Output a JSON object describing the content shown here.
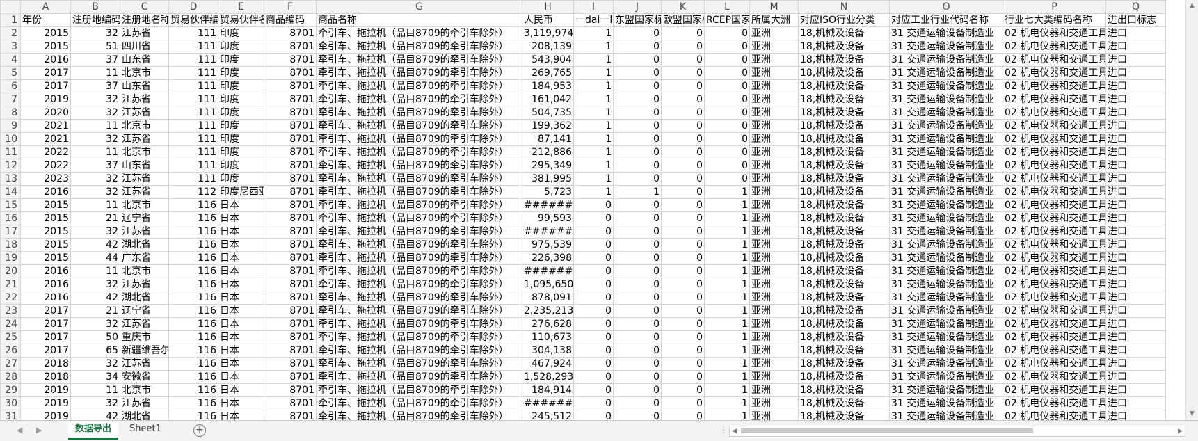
{
  "columns": [
    "A",
    "B",
    "C",
    "D",
    "E",
    "F",
    "G",
    "H",
    "I",
    "J",
    "K",
    "L",
    "M",
    "N",
    "O",
    "P",
    "Q"
  ],
  "header_row": [
    "年份",
    "注册地编码",
    "注册地名称",
    "贸易伙伴编码",
    "贸易伙伴名称",
    "商品编码",
    "商品名称",
    "人民币",
    "一dai一lu国家",
    "东盟国家标志",
    "欧盟国家标志",
    "RCEP国家标志",
    "所属大洲",
    "对应ISO行业分类",
    "对应工业行业代码名称",
    "行业七大类编码名称",
    "进出口标志"
  ],
  "rows": [
    [
      "2015",
      "32",
      "江苏省",
      "111",
      "印度",
      "8701",
      "牵引车、拖拉机（品目8709的牵引车除外）",
      "3,119,974",
      "1",
      "0",
      "0",
      "0",
      "亚洲",
      "18,机械及设备",
      "31 交通运输设备制造业",
      "02 机电仪器和交通工具",
      "进口"
    ],
    [
      "2015",
      "51",
      "四川省",
      "111",
      "印度",
      "8701",
      "牵引车、拖拉机（品目8709的牵引车除外）",
      "208,139",
      "1",
      "0",
      "0",
      "0",
      "亚洲",
      "18,机械及设备",
      "31 交通运输设备制造业",
      "02 机电仪器和交通工具",
      "进口"
    ],
    [
      "2016",
      "37",
      "山东省",
      "111",
      "印度",
      "8701",
      "牵引车、拖拉机（品目8709的牵引车除外）",
      "543,904",
      "1",
      "0",
      "0",
      "0",
      "亚洲",
      "18,机械及设备",
      "31 交通运输设备制造业",
      "02 机电仪器和交通工具",
      "进口"
    ],
    [
      "2017",
      "11",
      "北京市",
      "111",
      "印度",
      "8701",
      "牵引车、拖拉机（品目8709的牵引车除外）",
      "269,765",
      "1",
      "0",
      "0",
      "0",
      "亚洲",
      "18,机械及设备",
      "31 交通运输设备制造业",
      "02 机电仪器和交通工具",
      "进口"
    ],
    [
      "2017",
      "37",
      "山东省",
      "111",
      "印度",
      "8701",
      "牵引车、拖拉机（品目8709的牵引车除外）",
      "184,953",
      "1",
      "0",
      "0",
      "0",
      "亚洲",
      "18,机械及设备",
      "31 交通运输设备制造业",
      "02 机电仪器和交通工具",
      "进口"
    ],
    [
      "2019",
      "32",
      "江苏省",
      "111",
      "印度",
      "8701",
      "牵引车、拖拉机（品目8709的牵引车除外）",
      "161,042",
      "1",
      "0",
      "0",
      "0",
      "亚洲",
      "18,机械及设备",
      "31 交通运输设备制造业",
      "02 机电仪器和交通工具",
      "进口"
    ],
    [
      "2020",
      "32",
      "江苏省",
      "111",
      "印度",
      "8701",
      "牵引车、拖拉机（品目8709的牵引车除外）",
      "504,735",
      "1",
      "0",
      "0",
      "0",
      "亚洲",
      "18,机械及设备",
      "31 交通运输设备制造业",
      "02 机电仪器和交通工具",
      "进口"
    ],
    [
      "2021",
      "11",
      "北京市",
      "111",
      "印度",
      "8701",
      "牵引车、拖拉机（品目8709的牵引车除外）",
      "199,362",
      "1",
      "0",
      "0",
      "0",
      "亚洲",
      "18,机械及设备",
      "31 交通运输设备制造业",
      "02 机电仪器和交通工具",
      "进口"
    ],
    [
      "2021",
      "32",
      "江苏省",
      "111",
      "印度",
      "8701",
      "牵引车、拖拉机（品目8709的牵引车除外）",
      "87,141",
      "1",
      "0",
      "0",
      "0",
      "亚洲",
      "18,机械及设备",
      "31 交通运输设备制造业",
      "02 机电仪器和交通工具",
      "进口"
    ],
    [
      "2022",
      "11",
      "北京市",
      "111",
      "印度",
      "8701",
      "牵引车、拖拉机（品目8709的牵引车除外）",
      "212,886",
      "1",
      "0",
      "0",
      "0",
      "亚洲",
      "18,机械及设备",
      "31 交通运输设备制造业",
      "02 机电仪器和交通工具",
      "进口"
    ],
    [
      "2022",
      "37",
      "山东省",
      "111",
      "印度",
      "8701",
      "牵引车、拖拉机（品目8709的牵引车除外）",
      "295,349",
      "1",
      "0",
      "0",
      "0",
      "亚洲",
      "18,机械及设备",
      "31 交通运输设备制造业",
      "02 机电仪器和交通工具",
      "进口"
    ],
    [
      "2023",
      "32",
      "江苏省",
      "111",
      "印度",
      "8701",
      "牵引车、拖拉机（品目8709的牵引车除外）",
      "381,995",
      "1",
      "0",
      "0",
      "0",
      "亚洲",
      "18,机械及设备",
      "31 交通运输设备制造业",
      "02 机电仪器和交通工具",
      "进口"
    ],
    [
      "2016",
      "32",
      "江苏省",
      "112",
      "印度尼西亚",
      "8701",
      "牵引车、拖拉机（品目8709的牵引车除外）",
      "5,723",
      "1",
      "1",
      "0",
      "1",
      "亚洲",
      "18,机械及设备",
      "31 交通运输设备制造业",
      "02 机电仪器和交通工具",
      "进口"
    ],
    [
      "2015",
      "11",
      "北京市",
      "116",
      "日本",
      "8701",
      "牵引车、拖拉机（品目8709的牵引车除外）",
      "#######",
      "0",
      "0",
      "0",
      "1",
      "亚洲",
      "18,机械及设备",
      "31 交通运输设备制造业",
      "02 机电仪器和交通工具",
      "进口"
    ],
    [
      "2015",
      "21",
      "辽宁省",
      "116",
      "日本",
      "8701",
      "牵引车、拖拉机（品目8709的牵引车除外）",
      "99,593",
      "0",
      "0",
      "0",
      "1",
      "亚洲",
      "18,机械及设备",
      "31 交通运输设备制造业",
      "02 机电仪器和交通工具",
      "进口"
    ],
    [
      "2015",
      "32",
      "江苏省",
      "116",
      "日本",
      "8701",
      "牵引车、拖拉机（品目8709的牵引车除外）",
      "#######",
      "0",
      "0",
      "0",
      "1",
      "亚洲",
      "18,机械及设备",
      "31 交通运输设备制造业",
      "02 机电仪器和交通工具",
      "进口"
    ],
    [
      "2015",
      "42",
      "湖北省",
      "116",
      "日本",
      "8701",
      "牵引车、拖拉机（品目8709的牵引车除外）",
      "975,539",
      "0",
      "0",
      "0",
      "1",
      "亚洲",
      "18,机械及设备",
      "31 交通运输设备制造业",
      "02 机电仪器和交通工具",
      "进口"
    ],
    [
      "2015",
      "44",
      "广东省",
      "116",
      "日本",
      "8701",
      "牵引车、拖拉机（品目8709的牵引车除外）",
      "226,398",
      "0",
      "0",
      "0",
      "1",
      "亚洲",
      "18,机械及设备",
      "31 交通运输设备制造业",
      "02 机电仪器和交通工具",
      "进口"
    ],
    [
      "2016",
      "11",
      "北京市",
      "116",
      "日本",
      "8701",
      "牵引车、拖拉机（品目8709的牵引车除外）",
      "#######",
      "0",
      "0",
      "0",
      "1",
      "亚洲",
      "18,机械及设备",
      "31 交通运输设备制造业",
      "02 机电仪器和交通工具",
      "进口"
    ],
    [
      "2016",
      "32",
      "江苏省",
      "116",
      "日本",
      "8701",
      "牵引车、拖拉机（品目8709的牵引车除外）",
      "1,095,650",
      "0",
      "0",
      "0",
      "1",
      "亚洲",
      "18,机械及设备",
      "31 交通运输设备制造业",
      "02 机电仪器和交通工具",
      "进口"
    ],
    [
      "2016",
      "42",
      "湖北省",
      "116",
      "日本",
      "8701",
      "牵引车、拖拉机（品目8709的牵引车除外）",
      "878,091",
      "0",
      "0",
      "0",
      "1",
      "亚洲",
      "18,机械及设备",
      "31 交通运输设备制造业",
      "02 机电仪器和交通工具",
      "进口"
    ],
    [
      "2017",
      "21",
      "辽宁省",
      "116",
      "日本",
      "8701",
      "牵引车、拖拉机（品目8709的牵引车除外）",
      "2,235,213",
      "0",
      "0",
      "0",
      "1",
      "亚洲",
      "18,机械及设备",
      "31 交通运输设备制造业",
      "02 机电仪器和交通工具",
      "进口"
    ],
    [
      "2017",
      "32",
      "江苏省",
      "116",
      "日本",
      "8701",
      "牵引车、拖拉机（品目8709的牵引车除外）",
      "276,628",
      "0",
      "0",
      "0",
      "1",
      "亚洲",
      "18,机械及设备",
      "31 交通运输设备制造业",
      "02 机电仪器和交通工具",
      "进口"
    ],
    [
      "2017",
      "50",
      "重庆市",
      "116",
      "日本",
      "8701",
      "牵引车、拖拉机（品目8709的牵引车除外）",
      "110,673",
      "0",
      "0",
      "0",
      "1",
      "亚洲",
      "18,机械及设备",
      "31 交通运输设备制造业",
      "02 机电仪器和交通工具",
      "进口"
    ],
    [
      "2017",
      "65",
      "新疆维吾尔",
      "116",
      "日本",
      "8701",
      "牵引车、拖拉机（品目8709的牵引车除外）",
      "304,138",
      "0",
      "0",
      "0",
      "1",
      "亚洲",
      "18,机械及设备",
      "31 交通运输设备制造业",
      "02 机电仪器和交通工具",
      "进口"
    ],
    [
      "2018",
      "32",
      "江苏省",
      "116",
      "日本",
      "8701",
      "牵引车、拖拉机（品目8709的牵引车除外）",
      "467,924",
      "0",
      "0",
      "0",
      "1",
      "亚洲",
      "18,机械及设备",
      "31 交通运输设备制造业",
      "02 机电仪器和交通工具",
      "进口"
    ],
    [
      "2018",
      "34",
      "安徽省",
      "116",
      "日本",
      "8701",
      "牵引车、拖拉机（品目8709的牵引车除外）",
      "1,528,293",
      "0",
      "0",
      "0",
      "1",
      "亚洲",
      "18,机械及设备",
      "31 交通运输设备制造业",
      "02 机电仪器和交通工具",
      "进口"
    ],
    [
      "2019",
      "11",
      "北京市",
      "116",
      "日本",
      "8701",
      "牵引车、拖拉机（品目8709的牵引车除外）",
      "184,914",
      "0",
      "0",
      "0",
      "1",
      "亚洲",
      "18,机械及设备",
      "31 交通运输设备制造业",
      "02 机电仪器和交通工具",
      "进口"
    ],
    [
      "2019",
      "32",
      "江苏省",
      "116",
      "日本",
      "8701",
      "牵引车、拖拉机（品目8709的牵引车除外）",
      "#######",
      "0",
      "0",
      "0",
      "1",
      "亚洲",
      "18,机械及设备",
      "31 交通运输设备制造业",
      "02 机电仪器和交通工具",
      "进口"
    ],
    [
      "2019",
      "42",
      "湖北省",
      "116",
      "日本",
      "8701",
      "牵引车、拖拉机（品目8709的牵引车除外）",
      "245,512",
      "0",
      "0",
      "0",
      "1",
      "亚洲",
      "18,机械及设备",
      "31 交通运输设备制造业",
      "02 机电仪器和交通工具",
      "进口"
    ]
  ],
  "tabs": [
    {
      "label": "数据导出",
      "active": true
    },
    {
      "label": "Sheet1",
      "active": false
    }
  ],
  "colors": {
    "accent": "#217346",
    "header_bg": "#f3f3f3",
    "grid": "#d4d4d4"
  }
}
